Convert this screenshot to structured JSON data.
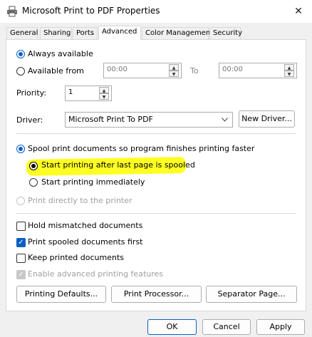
{
  "window": {
    "title": "Microsoft Print to PDF Properties",
    "close_glyph": "✕",
    "title_icon": "printer-icon"
  },
  "tabs": [
    {
      "label": "General"
    },
    {
      "label": "Sharing"
    },
    {
      "label": "Ports"
    },
    {
      "label": "Advanced",
      "active": true
    },
    {
      "label": "Color Management"
    },
    {
      "label": "Security"
    }
  ],
  "availability": {
    "always_available": "Always available",
    "available_from": "Available from",
    "from_time": "00:00",
    "to_label": "To",
    "to_time": "00:00"
  },
  "priority": {
    "label": "Priority:",
    "value": "1"
  },
  "driver": {
    "label": "Driver:",
    "value": "Microsoft Print To PDF",
    "new_driver_button": "New Driver..."
  },
  "spooling": {
    "spool_option": "Spool print documents so program finishes printing faster",
    "after_last_page": "Start printing after last page is spooled",
    "immediately": "Start printing immediately",
    "direct": "Print directly to the printer"
  },
  "options": {
    "hold_mismatched": "Hold mismatched documents",
    "print_spooled_first": "Print spooled documents first",
    "keep_printed": "Keep printed documents",
    "advanced_features": "Enable advanced printing features"
  },
  "panel_buttons": {
    "printing_defaults": "Printing Defaults...",
    "print_processor": "Print Processor...",
    "separator_page": "Separator Page..."
  },
  "dialog_buttons": {
    "ok": "OK",
    "cancel": "Cancel",
    "apply": "Apply"
  },
  "colors": {
    "accent": "#0a5fc4",
    "highlight": "#fffe22"
  }
}
